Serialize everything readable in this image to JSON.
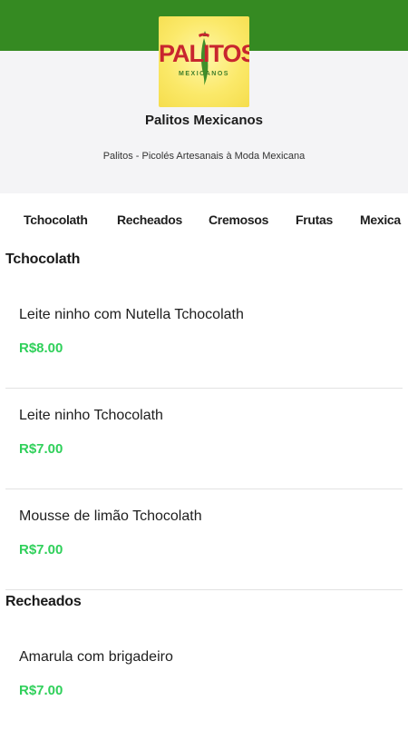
{
  "store": {
    "logo_text": "PALITOS",
    "logo_subtext": "MEXICANOS",
    "name": "Palitos Mexicanos",
    "description": "Palitos - Picolés Artesanais à Moda Mexicana"
  },
  "tabs": [
    "Tchocolath",
    "Recheados",
    "Cremosos",
    "Frutas",
    "Mexica"
  ],
  "colors": {
    "topbar": "#358a22",
    "price": "#2fd05a"
  },
  "sections": [
    {
      "title": "Tchocolath",
      "items": [
        {
          "name": "Leite ninho com Nutella Tchocolath",
          "price": "R$8.00"
        },
        {
          "name": "Leite ninho Tchocolath",
          "price": "R$7.00"
        },
        {
          "name": "Mousse de limão Tchocolath",
          "price": "R$7.00"
        }
      ]
    },
    {
      "title": "Recheados",
      "items": [
        {
          "name": "Amarula com brigadeiro",
          "price": "R$7.00"
        }
      ]
    }
  ]
}
